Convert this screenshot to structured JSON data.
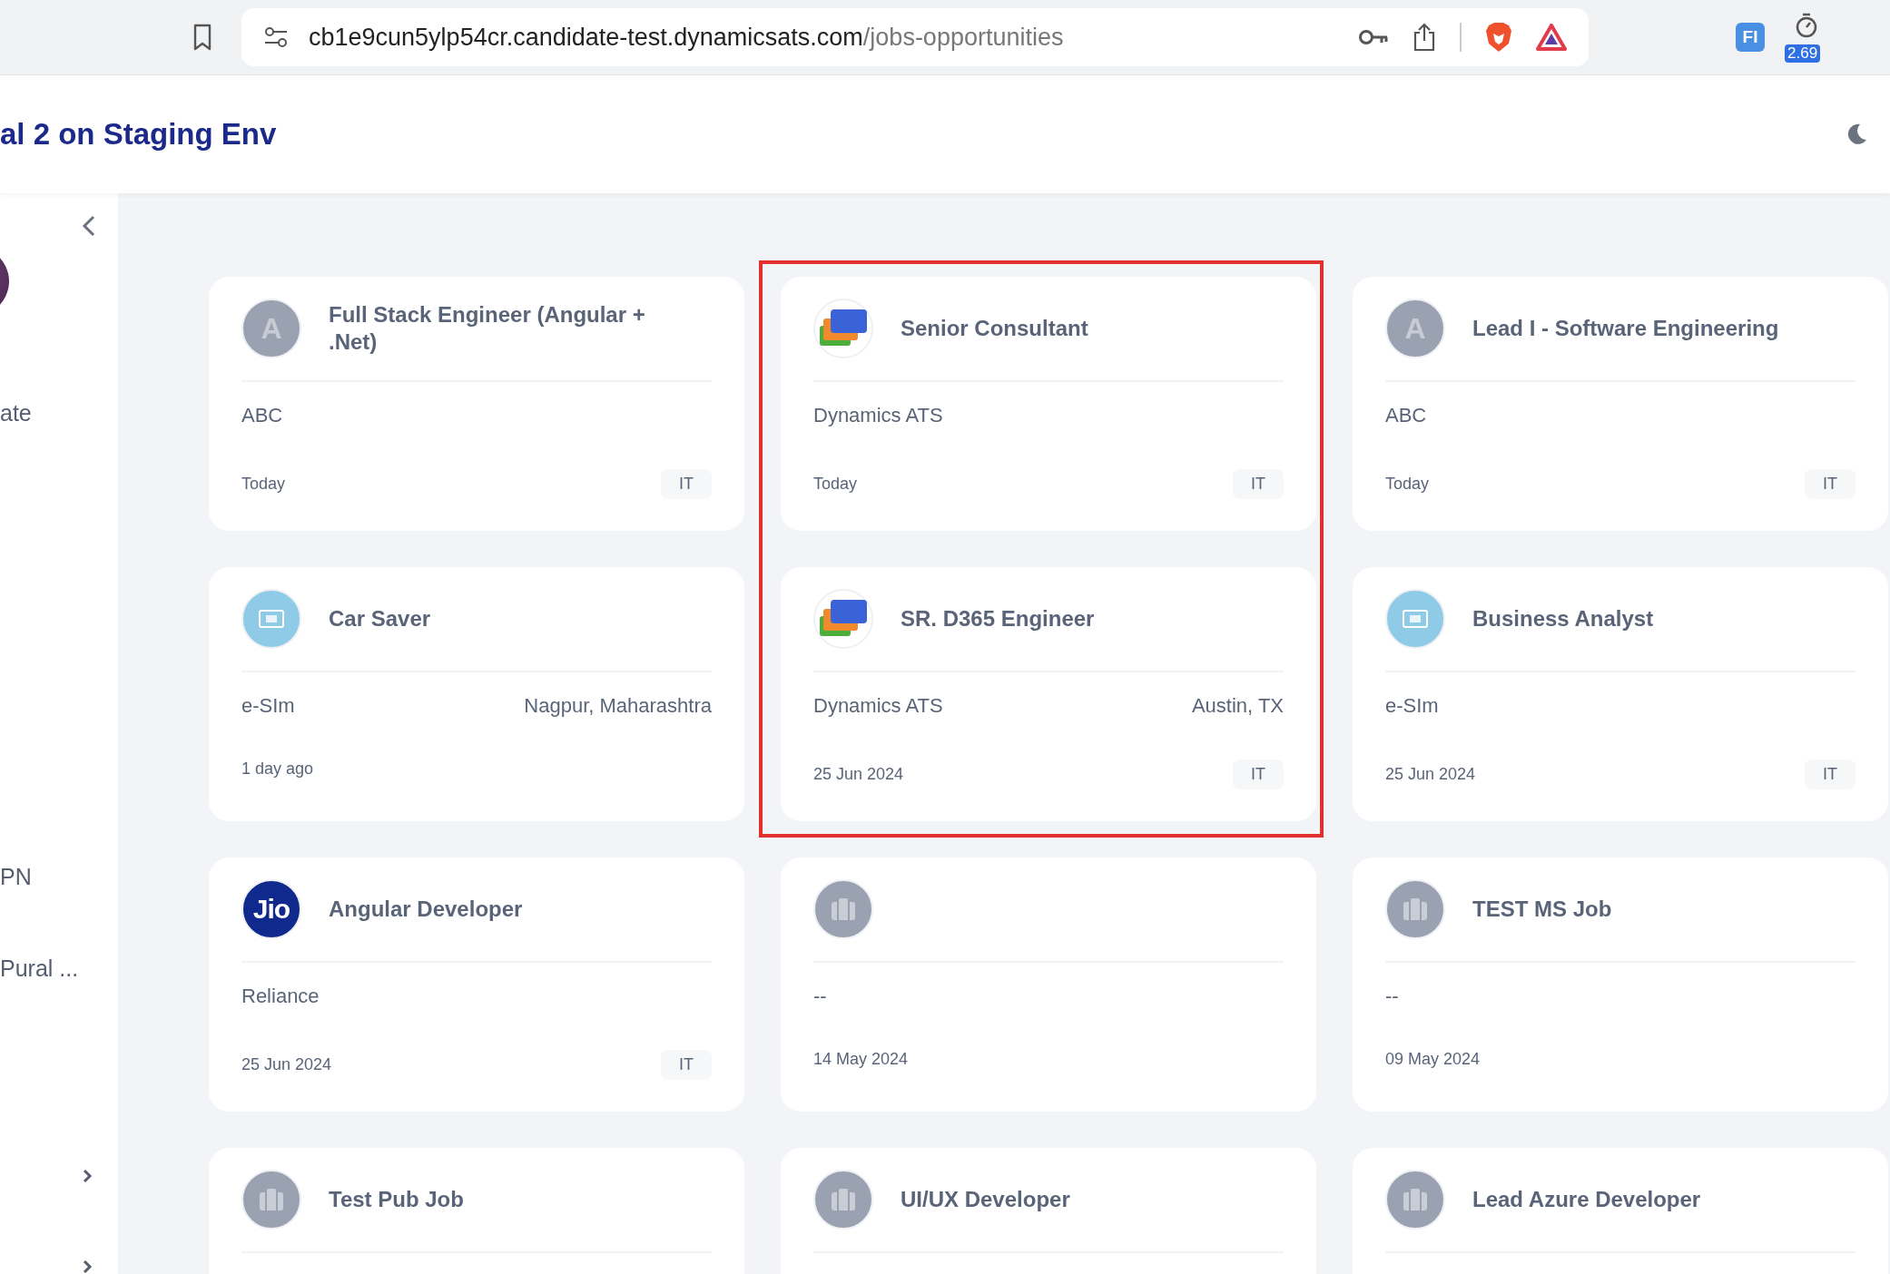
{
  "browser": {
    "url_host": "cb1e9cun5ylp54cr.candidate-test.dynamicsats.com",
    "url_path": "/jobs-opportunities",
    "extension_badge": "2.69",
    "extension_label": "FI"
  },
  "header": {
    "title": "al 2 on Staging Env"
  },
  "sidebar": {
    "items": [
      {
        "label": "ate"
      },
      {
        "label": "PN"
      },
      {
        "label": "Pural ..."
      }
    ]
  },
  "jobs": [
    {
      "kind": "letter",
      "logo_text": "A",
      "title": "Full Stack Engineer (Angular + .Net)",
      "company": "ABC",
      "date": "Today",
      "tag": "IT",
      "highlighted": false
    },
    {
      "kind": "stack",
      "title": "Senior Consultant",
      "company": "Dynamics ATS",
      "date": "Today",
      "tag": "IT",
      "highlighted": true
    },
    {
      "kind": "letter",
      "logo_text": "A",
      "title": "Lead I - Software Engineering",
      "company": "ABC",
      "date": "Today",
      "tag": "IT",
      "highlighted": false
    },
    {
      "kind": "chip",
      "title": "Car Saver",
      "company": "e-SIm",
      "location": "Nagpur, Maharashtra",
      "date": "1 day ago",
      "highlighted": false
    },
    {
      "kind": "stack",
      "title": "SR. D365 Engineer",
      "company": "Dynamics ATS",
      "location": "Austin, TX",
      "date": "25 Jun 2024",
      "tag": "IT",
      "highlighted": true
    },
    {
      "kind": "chip",
      "title": "Business Analyst",
      "company": "e-SIm",
      "date": "25 Jun 2024",
      "tag": "IT",
      "highlighted": false
    },
    {
      "kind": "jio",
      "logo_text": "Jio",
      "title": "Angular Developer",
      "company": "Reliance",
      "date": "25 Jun 2024",
      "tag": "IT",
      "highlighted": false
    },
    {
      "kind": "briefcase",
      "company": "--",
      "date": "14 May 2024",
      "highlighted": false
    },
    {
      "kind": "briefcase",
      "title": "TEST MS Job",
      "company": "--",
      "date": "09 May 2024",
      "highlighted": false
    },
    {
      "kind": "briefcase",
      "title": "Test Pub Job",
      "highlighted": false
    },
    {
      "kind": "briefcase",
      "title": "UI/UX Developer",
      "highlighted": false
    },
    {
      "kind": "briefcase",
      "title": "Lead Azure Developer",
      "highlighted": false
    }
  ]
}
